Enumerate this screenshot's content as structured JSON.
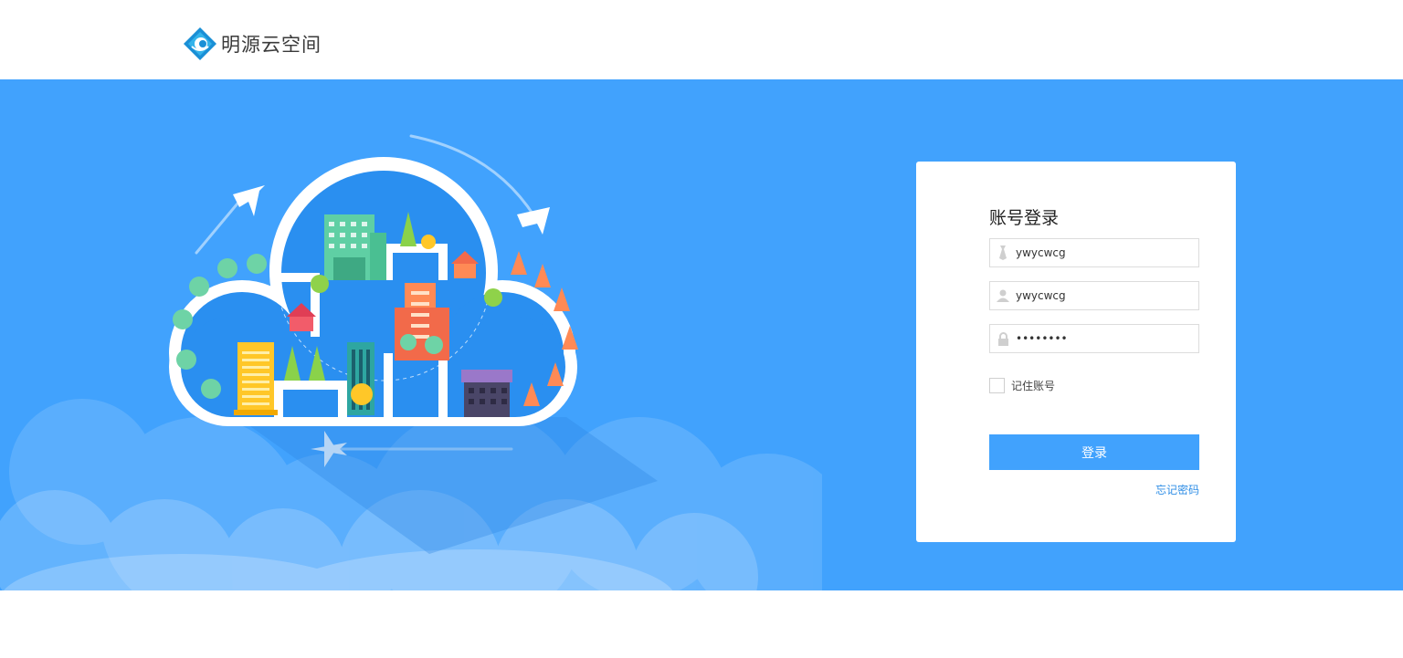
{
  "header": {
    "logo_text": "明源云空间"
  },
  "login": {
    "title": "账号登录",
    "field1_value": "ywycwcg",
    "field2_value": "ywycwcg",
    "password_value": "••••••••",
    "remember_label": "记住账号",
    "submit_label": "登录",
    "forgot_label": "忘记密码"
  },
  "colors": {
    "brand_blue": "#41a2fd",
    "link_blue": "#2f8ee6"
  }
}
